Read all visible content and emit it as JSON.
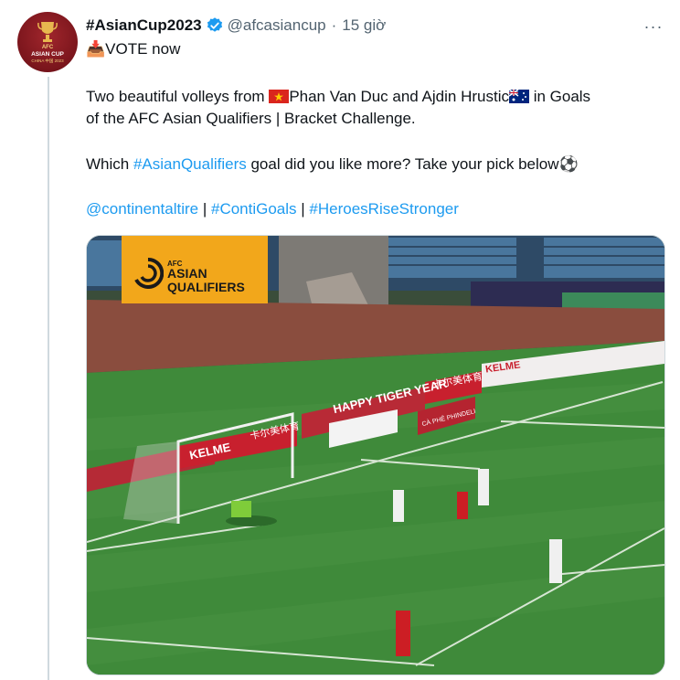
{
  "tweet": {
    "display_name": "#AsianCup2023",
    "handle": "@afcasiancup",
    "separator": "·",
    "timestamp": "15 giờ",
    "more_glyph": "···",
    "vote_emoji": "📥",
    "vote_text": "VOTE now",
    "line1_a": "Two beautiful volleys from ",
    "player1": "Phan Van Duc and Ajdin Hrustic",
    "line1_b": " in Goals",
    "line2": "of the AFC Asian Qualifiers | Bracket Challenge.",
    "question_a": "Which ",
    "hashtag_main": "#AsianQualifiers",
    "question_b": " goal did you like more? Take your pick below",
    "ball_emoji": "⚽",
    "mention": "@continentaltire",
    "sep1": " | ",
    "hashtag2": "#ContiGoals",
    "sep2": " | ",
    "hashtag3": "#HeroesRiseStronger"
  },
  "avatar": {
    "afc": "AFC",
    "cup": "ASIAN CUP",
    "host": "CHINA 中国 2023"
  },
  "media": {
    "logo_small": "AFC",
    "logo_line1": "ASIAN",
    "logo_line2": "QUALIFIERS",
    "board_happy": "HAPPY TIGER YEAR",
    "board_kelme": "KELME",
    "board_cafe": "CÀ PHÊ PHINDELI",
    "board_cn": "卡尔美体育",
    "board_cn2": "卡尔美体育"
  },
  "colors": {
    "link": "#1d9bf0",
    "secondary": "#536471",
    "verified": "#1d9bf0",
    "logo_bg": "#f2a71b"
  }
}
